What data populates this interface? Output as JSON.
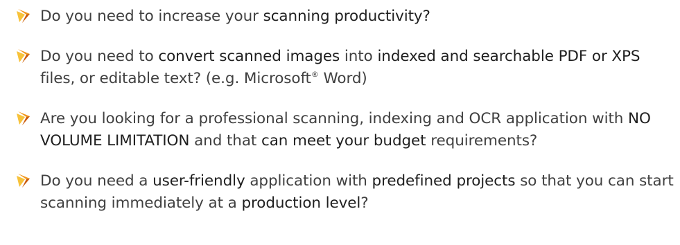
{
  "icon": {
    "name": "chevron-arrow-bullet-icon",
    "colors": {
      "light": "#f7c23a",
      "main": "#f2981e",
      "dark": "#c95a10"
    }
  },
  "items": [
    {
      "parts": [
        "Do you need to increase your ",
        "scanning productivity?"
      ]
    },
    {
      "parts": [
        "Do you need to ",
        "convert scanned images",
        " into ",
        "indexed and searchable PDF or XPS",
        " files, or editable text? (e.g. Microsoft",
        "®",
        " Word)"
      ]
    },
    {
      "parts": [
        "Are you looking for a professional scanning, indexing and OCR application with ",
        "NO VOLUME LIMITATION",
        " and that ",
        "can meet your budget",
        " requirements?"
      ]
    },
    {
      "parts": [
        "Do you need a ",
        "user-friendly",
        " application with ",
        "predefined projects",
        " so that you can start scanning immediately at a ",
        "production level",
        "?"
      ]
    }
  ]
}
